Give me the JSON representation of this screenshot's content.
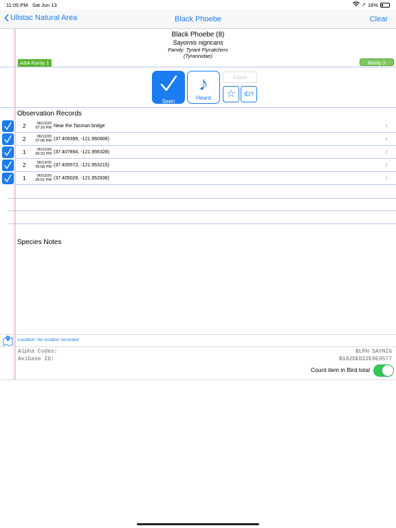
{
  "status_bar": {
    "time": "11:05 PM",
    "date": "Sat Jun 13",
    "battery": "16%"
  },
  "nav": {
    "back_label": "Ulistac Natural Area",
    "title": "Black Phoebe",
    "clear_label": "Clear"
  },
  "species": {
    "title": "Black Phoebe (8)",
    "scientific_name": "Sayornis nigricans",
    "family": "Family: Tyrant Flycatchers",
    "family_latin": "(Tyrannidae)",
    "aba_rarity": "ABA Rarity 1",
    "rarity": "Rarity 2"
  },
  "actions": {
    "seen_label": "Seen",
    "heard_label": "Heard",
    "count_placeholder": "Count",
    "id_label": "ID?"
  },
  "observations": {
    "title": "Observation Records",
    "rows": [
      {
        "count": "2",
        "date": "06/13/20",
        "time": "07:16 PM",
        "location": "Near the Tasman bridge"
      },
      {
        "count": "2",
        "date": "06/13/20",
        "time": "07:06 PM",
        "location": "(37.409399, -121.960906)"
      },
      {
        "count": "1",
        "date": "06/13/20",
        "time": "06:32 PM",
        "location": "(37.407894, -121.956328)"
      },
      {
        "count": "2",
        "date": "06/13/20",
        "time": "05:58 PM",
        "location": "(37.405572, -121.953215)"
      },
      {
        "count": "1",
        "date": "06/13/20",
        "time": "05:51 PM",
        "location": "(37.405028, -121.952836)"
      }
    ]
  },
  "notes": {
    "title": "Species Notes"
  },
  "location": {
    "text": "Location: No location recorded"
  },
  "codes": {
    "alpha_label": "Alpha Codes:",
    "alpha_value": "BLPH SAYNIG",
    "avibase_label": "Avibase ID:",
    "avibase_value": "B182DED22E9E9577"
  },
  "toggle": {
    "label": "Count item in Bird total",
    "on": true
  },
  "colors": {
    "accent": "#1a7cf0",
    "green": "#5ab52e",
    "toggle_on": "#35c759"
  },
  "icons": {
    "seen": "checkmark-icon",
    "heard": "music-note-icon",
    "favorite": "star-icon",
    "location": "map-pin-icon",
    "back": "chevron-left-icon"
  }
}
